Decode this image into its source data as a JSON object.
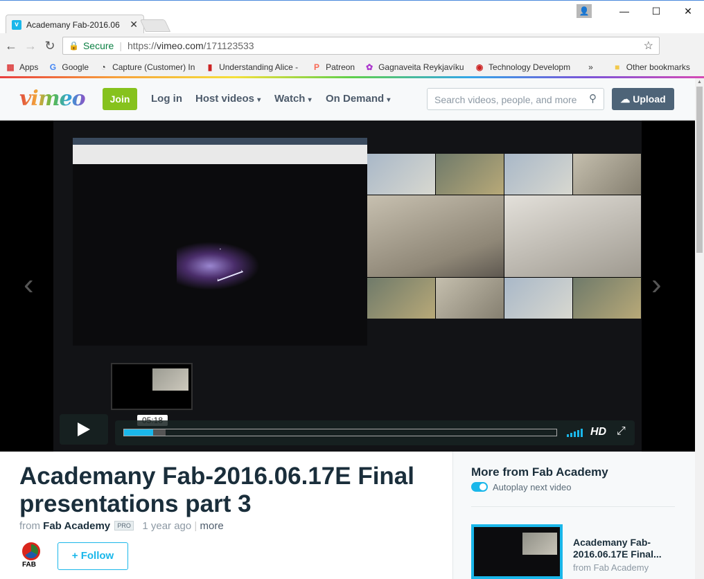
{
  "browser": {
    "tab_title": "Academany Fab-2016.06",
    "tab_close": "✕",
    "address": {
      "secure_label": "Secure",
      "url_scheme": "https://",
      "url_host": "vimeo.com",
      "url_path": "/171123533"
    },
    "bookmarks": [
      {
        "label": "Apps",
        "icon": "apps-grid-icon"
      },
      {
        "label": "Google",
        "icon": "google-icon"
      },
      {
        "label": "Capture (Customer) In",
        "icon": "capture-icon"
      },
      {
        "label": "Understanding Alice -",
        "icon": "bookmark-icon"
      },
      {
        "label": "Patreon",
        "icon": "patreon-icon"
      },
      {
        "label": "Gagnaveita Reykjavíku",
        "icon": "gagnaveita-icon"
      },
      {
        "label": "Technology Developm",
        "icon": "eye-icon"
      }
    ],
    "bookmarks_overflow": "»",
    "other_bookmarks": "Other bookmarks"
  },
  "vimeo_header": {
    "logo": "vimeo",
    "join": "Join",
    "login": "Log in",
    "host_videos": "Host videos",
    "watch": "Watch",
    "on_demand": "On Demand",
    "search_placeholder": "Search videos, people, and more",
    "upload": "Upload"
  },
  "player": {
    "hover_time": "05:18",
    "quality": "HD",
    "progress_fraction": 0.067,
    "buffered_fraction": 0.096
  },
  "video": {
    "title": "Academany Fab-2016.06.17E Final presentations part 3",
    "from_label": "from",
    "channel": "Fab Academy",
    "badge": "PRO",
    "age": "1 year ago",
    "more": "more",
    "follow": "Follow",
    "avatar_text": "FAB"
  },
  "sidebar": {
    "heading": "More from Fab Academy",
    "autoplay_label": "Autoplay next video",
    "autoplay_on": true,
    "next_title": "Academany Fab-2016.06.17E Final...",
    "next_from": "from Fab Academy"
  },
  "colors": {
    "accent": "#1ab7ea",
    "join": "#86c21d",
    "upload": "#4e6478",
    "text": "#1a2e3b"
  }
}
